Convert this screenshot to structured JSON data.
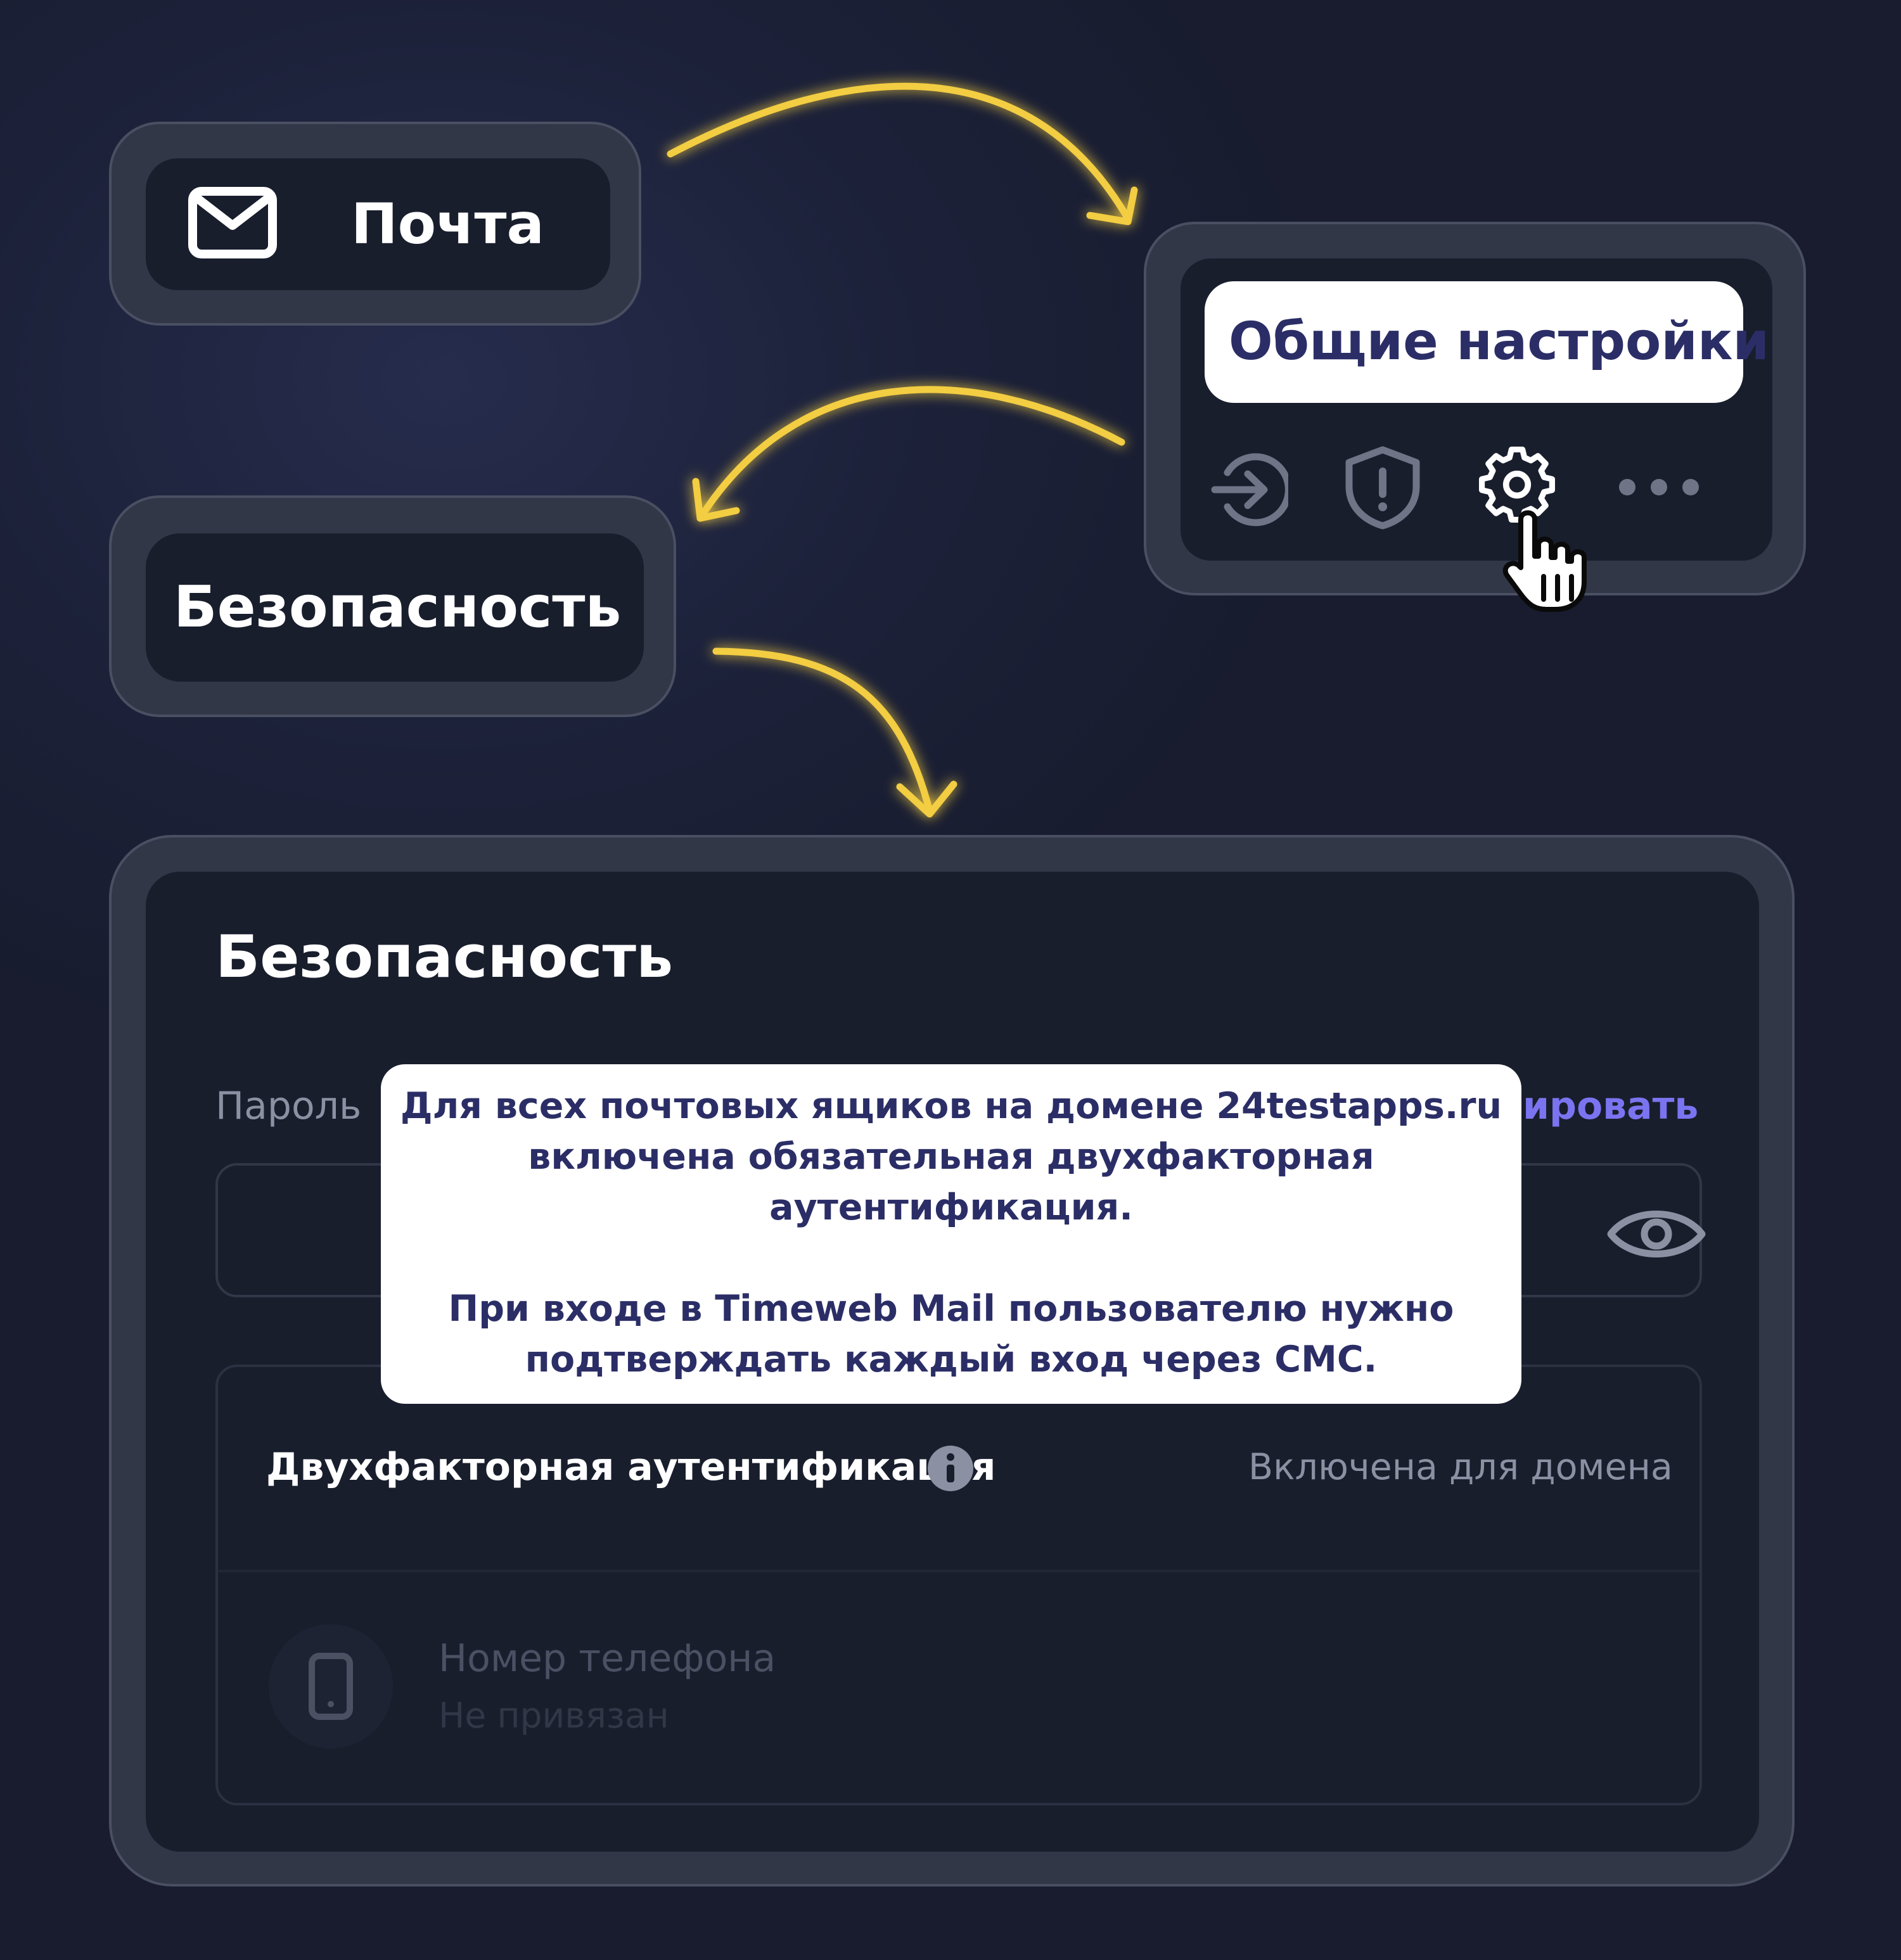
{
  "steps": {
    "mail_label": "Почта",
    "general_settings_label": "Общие настройки",
    "security_label": "Безопасность"
  },
  "panel": {
    "title": "Безопасность",
    "password_label": "Пароль",
    "edit_link_partial": "рировать",
    "tooltip": {
      "line1": "Для всех почтовых ящиков на домене 24testapps.ru",
      "line2": "включена обязательная двухфакторная",
      "line3": "аутентификация.",
      "line4": "При входе в Timeweb Mail пользователю нужно",
      "line5": "подтверждать каждый вход через СМС."
    },
    "two_factor": {
      "label": "Двухфакторная аутентификация",
      "status": "Включена для домена"
    },
    "phone": {
      "title": "Номер телефона",
      "subtitle": "Не привязан"
    }
  },
  "icons": [
    "mail-icon",
    "login-icon",
    "shield-alert-icon",
    "gear-icon",
    "more-icon",
    "hand-cursor-icon",
    "eye-icon",
    "info-icon",
    "phone-icon",
    "arrow-icon"
  ],
  "colors": {
    "background": "#1c2139",
    "card": "#191e2d",
    "arrow": "#f3cd43",
    "link": "#7b74f0",
    "tooltip_text": "#2b2e66"
  }
}
